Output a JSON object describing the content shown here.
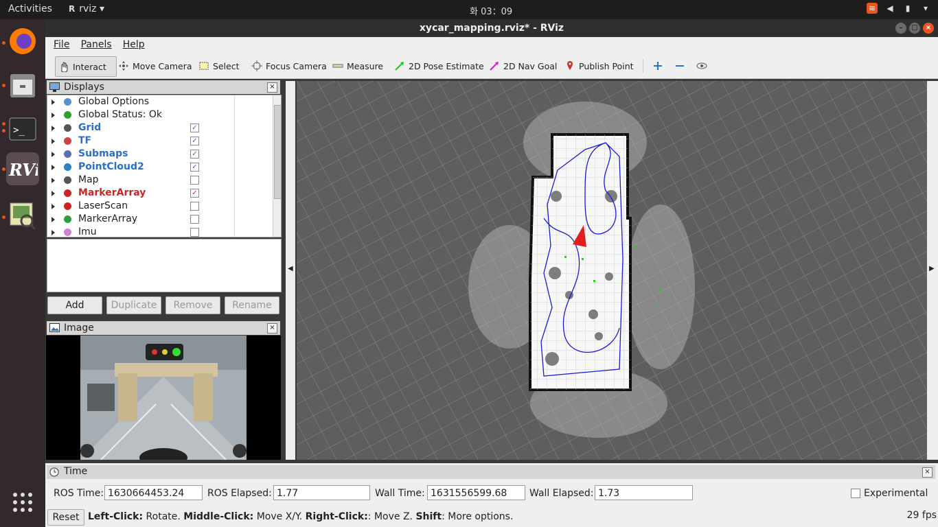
{
  "topbar": {
    "activities": "Activities",
    "app_name": "rviz",
    "clock": "화 03：09"
  },
  "window": {
    "title": "xycar_mapping.rviz* - RViz"
  },
  "menu": {
    "file": "File",
    "panels": "Panels",
    "help": "Help"
  },
  "toolbar": {
    "interact": "Interact",
    "move_camera": "Move Camera",
    "select": "Select",
    "focus_camera": "Focus Camera",
    "measure": "Measure",
    "pose_estimate": "2D Pose Estimate",
    "nav_goal": "2D Nav Goal",
    "publish_point": "Publish Point"
  },
  "displays": {
    "title": "Displays",
    "items": [
      {
        "label": "Global Options",
        "checked": null,
        "color": "#222222",
        "bold": false
      },
      {
        "label": "Global Status: Ok",
        "checked": null,
        "color": "#222222",
        "bold": false
      },
      {
        "label": "Grid",
        "checked": true,
        "color": "#2a6fc9",
        "bold": true
      },
      {
        "label": "TF",
        "checked": true,
        "color": "#2a6fc9",
        "bold": true
      },
      {
        "label": "Submaps",
        "checked": true,
        "color": "#2a6fc9",
        "bold": true
      },
      {
        "label": "PointCloud2",
        "checked": true,
        "color": "#2a6fc9",
        "bold": true
      },
      {
        "label": "Map",
        "checked": false,
        "color": "#222222",
        "bold": false
      },
      {
        "label": "MarkerArray",
        "checked": true,
        "color": "#c62828",
        "bold": true
      },
      {
        "label": "LaserScan",
        "checked": false,
        "color": "#222222",
        "bold": false
      },
      {
        "label": "MarkerArray",
        "checked": false,
        "color": "#222222",
        "bold": false
      },
      {
        "label": "Imu",
        "checked": false,
        "color": "#222222",
        "bold": false
      }
    ],
    "buttons": {
      "add": "Add",
      "duplicate": "Duplicate",
      "remove": "Remove",
      "rename": "Rename"
    }
  },
  "image_panel": {
    "title": "Image"
  },
  "time_panel": {
    "title": "Time",
    "ros_time_label": "ROS Time:",
    "ros_time": "1630664453.24",
    "ros_elapsed_label": "ROS Elapsed:",
    "ros_elapsed": "1.77",
    "wall_time_label": "Wall Time:",
    "wall_time": "1631556599.68",
    "wall_elapsed_label": "Wall Elapsed:",
    "wall_elapsed": "1.73",
    "experimental": "Experimental"
  },
  "statusbar": {
    "reset": "Reset",
    "left_click": "Left-Click:",
    "rotate": " Rotate. ",
    "middle_click": "Middle-Click:",
    "move_xy": " Move X/Y. ",
    "right_click": "Right-Click:",
    "move_z": ": Move Z. ",
    "shift": "Shift",
    "more": ": More options.",
    "fps": "29 fps"
  }
}
